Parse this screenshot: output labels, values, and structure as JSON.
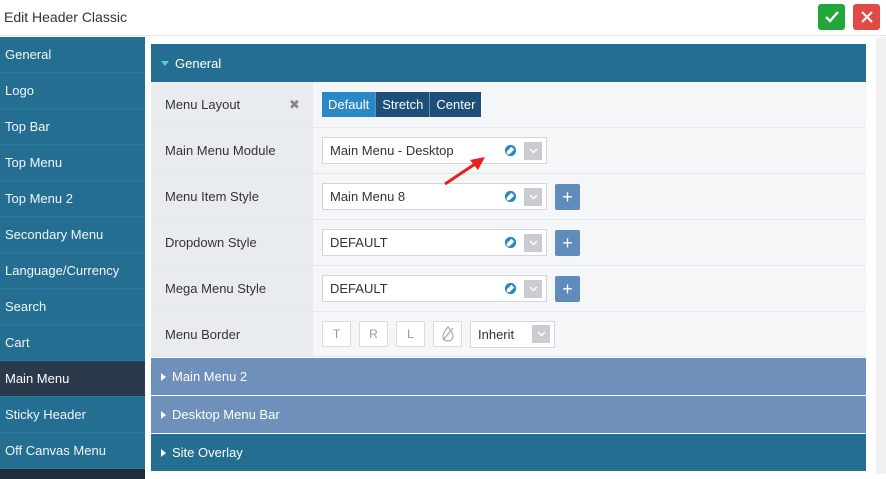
{
  "window": {
    "title": "Edit Header Classic"
  },
  "actions": {
    "save_icon": "check-icon",
    "close_icon": "close-icon"
  },
  "sidebar": {
    "items": [
      {
        "label": "General",
        "active": false
      },
      {
        "label": "Logo",
        "active": false
      },
      {
        "label": "Top Bar",
        "active": false
      },
      {
        "label": "Top Menu",
        "active": false
      },
      {
        "label": "Top Menu 2",
        "active": false
      },
      {
        "label": "Secondary Menu",
        "active": false
      },
      {
        "label": "Language/Currency",
        "active": false
      },
      {
        "label": "Search",
        "active": false
      },
      {
        "label": "Cart",
        "active": false
      },
      {
        "label": "Main Menu",
        "active": true
      },
      {
        "label": "Sticky Header",
        "active": false
      },
      {
        "label": "Off Canvas Menu",
        "active": false
      }
    ]
  },
  "panels": {
    "general": {
      "title": "General"
    },
    "main_menu_2": {
      "title": "Main Menu 2"
    },
    "desktop_menu_bar": {
      "title": "Desktop Menu Bar"
    },
    "site_overlay": {
      "title": "Site Overlay"
    }
  },
  "fields": {
    "menu_layout": {
      "label": "Menu Layout",
      "options": [
        "Default",
        "Stretch",
        "Center"
      ],
      "selected": "Default"
    },
    "main_menu_module": {
      "label": "Main Menu Module",
      "value": "Main Menu - Desktop"
    },
    "menu_item_style": {
      "label": "Menu Item Style",
      "value": "Main Menu 8"
    },
    "dropdown_style": {
      "label": "Dropdown Style",
      "value": "DEFAULT"
    },
    "mega_menu_style": {
      "label": "Mega Menu Style",
      "value": "DEFAULT"
    },
    "menu_border": {
      "label": "Menu Border",
      "buttons": [
        "T",
        "R",
        "L"
      ],
      "value": "Inherit"
    }
  },
  "colors": {
    "sidebar": "#246e92",
    "sidebar_active": "#2b3a4a",
    "panel_collapsed": "#6f90ba",
    "save_green": "#21a73b",
    "close_red": "#e24a47",
    "annotation_arrow": "#e8201a"
  }
}
